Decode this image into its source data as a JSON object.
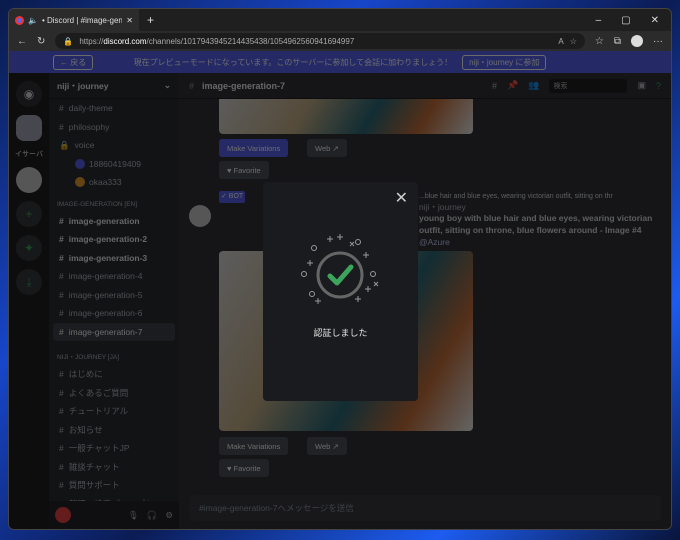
{
  "browser": {
    "tab_title": "• Discord | #image-generat",
    "url_prefix": "https://",
    "url_domain": "discord.com",
    "url_path": "/channels/1017943945214435438/1054962560941694997",
    "new_tab": "+",
    "min": "–",
    "max": "▢",
    "close": "✕",
    "more": "···"
  },
  "banner": {
    "back": "← 戻る",
    "text": "現在プレビューモードになっています。このサーバーに参加して会話に加わりましょう！",
    "join": "niji・journey に参加"
  },
  "rail": {
    "partial_label": "イサーバ"
  },
  "sidebar": {
    "server": "niji・journey",
    "channels_top": [
      "daily-theme",
      "philosophy"
    ],
    "voice": "voice",
    "voice_users": [
      "18860419409",
      "okaa333"
    ],
    "cat1": "IMAGE-GENERATION [EN]",
    "cat1_channels": [
      {
        "name": "image-generation",
        "unread": true
      },
      {
        "name": "image-generation-2",
        "unread": true
      },
      {
        "name": "image-generation-3",
        "unread": true
      },
      {
        "name": "image-generation-4"
      },
      {
        "name": "image-generation-5"
      },
      {
        "name": "image-generation-6"
      },
      {
        "name": "image-generation-7",
        "selected": true
      }
    ],
    "cat2": "NIJI・JOURNEY [JA]",
    "cat2_channels": [
      "はじめに",
      "よくあるご質問",
      "チュートリアル",
      "お知らせ",
      "一般チャットJP",
      "雑談チャット",
      "質問サポート",
      "整理・設定プロンプト"
    ]
  },
  "header": {
    "channel": "image-generation-7",
    "search_placeholder": "検索"
  },
  "messages": {
    "make_variations": "Make Variations",
    "web": "Web ↗",
    "favorite": "♥ Favorite",
    "bot_tag": "✓ BOT",
    "reply_preview": "...blue hair and blue eyes, wearing victorian outfit, sitting on thr",
    "author": "niji・journey",
    "body": "young boy with blue hair and blue eyes, wearing victorian outfit, sitting on throne, blue flowers around - Image #4",
    "mention": "@Azure"
  },
  "composer": {
    "placeholder": "#image-generation-7へメッセージを送信"
  },
  "modal": {
    "message": "認証しました",
    "close": "✕"
  },
  "colors": {
    "accent": "#5865f2",
    "success": "#3ba55c"
  }
}
